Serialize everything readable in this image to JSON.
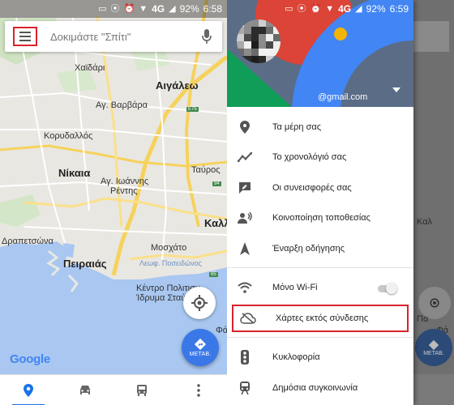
{
  "left": {
    "status": {
      "network": "4G",
      "battery": "92%",
      "time": "6:58"
    },
    "search": {
      "placeholder": "Δοκιμάστε \"Σπίτι\""
    },
    "map_labels": {
      "chaidari": "Χαϊδάρι",
      "aigaleo": "Αιγάλεω",
      "ag_varvara": "Αγ. Βαρβάρα",
      "korydallos": "Κορυδαλλός",
      "nikaia": "Νίκαια",
      "ag_ioannis_rentis_1": "Αγ. Ιωάννης",
      "ag_ioannis_rentis_2": "Ρέντης",
      "tavros": "Ταύρος",
      "kall": "Καλλ",
      "drapetsona": "Δραπετσώνα",
      "peiraias": "Πειραιάς",
      "moschato": "Μοσχάτο",
      "kentro_1": "Κέντρο Πολιτισμ",
      "kentro_2": "Ίδρυμα Σταύρος",
      "leof": "Λεωφ. Ποσειδώνος",
      "fa": "Φά",
      "e75": "E75",
      "e94": "94",
      "e65": "65"
    },
    "directions_label": "ΜΕΤΑΒ.",
    "google_logo": "Google"
  },
  "right": {
    "status": {
      "network": "4G",
      "battery": "92%",
      "time": "6:59"
    },
    "account": {
      "email": "@gmail.com"
    },
    "menu": [
      {
        "icon": "pin-icon",
        "label": "Τα μέρη σας"
      },
      {
        "icon": "timeline-icon",
        "label": "Το χρονολόγιό σας"
      },
      {
        "icon": "contributions-icon",
        "label": "Οι συνεισφορές σας"
      },
      {
        "icon": "location-sharing-icon",
        "label": "Κοινοποίηση τοποθεσίας"
      },
      {
        "icon": "navigation-icon",
        "label": "Έναρξη οδήγησης"
      },
      {
        "icon": "wifi-icon",
        "label": "Μόνο Wi-Fi",
        "toggle": false
      },
      {
        "icon": "offline-cloud-icon",
        "label": "Χάρτες εκτός σύνδεσης",
        "highlighted": true
      },
      {
        "icon": "traffic-icon",
        "label": "Κυκλοφορία"
      },
      {
        "icon": "transit-icon",
        "label": "Δημόσια συγκοινωνία"
      }
    ],
    "backmap_labels": {
      "kall": "Καλ",
      "pa": "Πα",
      "fa": "Φά"
    },
    "backmap_directions": "ΜΕΤΑΒ."
  },
  "colors": {
    "accent_blue": "#3b78e7",
    "highlight_red": "#d9232d",
    "water": "#a9c7f0",
    "land": "#e9e7e2"
  }
}
